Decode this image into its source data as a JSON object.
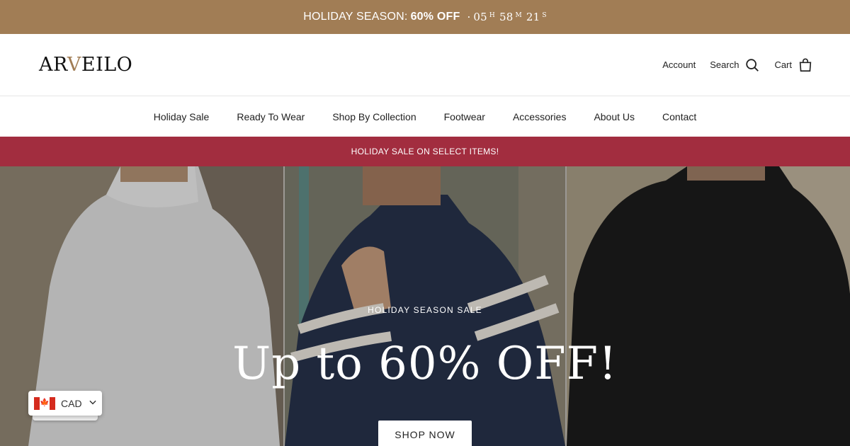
{
  "promo": {
    "label": "HOLIDAY SEASON:",
    "offer": "60% OFF",
    "separator": "·",
    "hours": "05",
    "hours_unit": "H",
    "minutes": "58",
    "minutes_unit": "M",
    "seconds": "21",
    "seconds_unit": "S"
  },
  "header": {
    "logo_pre": "AR",
    "logo_v": "V",
    "logo_post": "EILO",
    "account": "Account",
    "search": "Search",
    "cart": "Cart"
  },
  "nav": {
    "items": [
      "Holiday Sale",
      "Ready To Wear",
      "Shop By Collection",
      "Footwear",
      "Accessories",
      "About Us",
      "Contact"
    ]
  },
  "ribbon": {
    "text": "HOLIDAY SALE ON SELECT ITEMS!"
  },
  "hero": {
    "eyebrow": "HOLIDAY SEASON SALE",
    "title": "Up to 60% OFF!",
    "button": "SHOP NOW"
  },
  "currency": {
    "code": "CAD",
    "flag": "canada-flag-icon"
  },
  "colors": {
    "promo_bg": "#a17d55",
    "ribbon_bg": "#a22d3f",
    "accent": "#a17d55"
  }
}
